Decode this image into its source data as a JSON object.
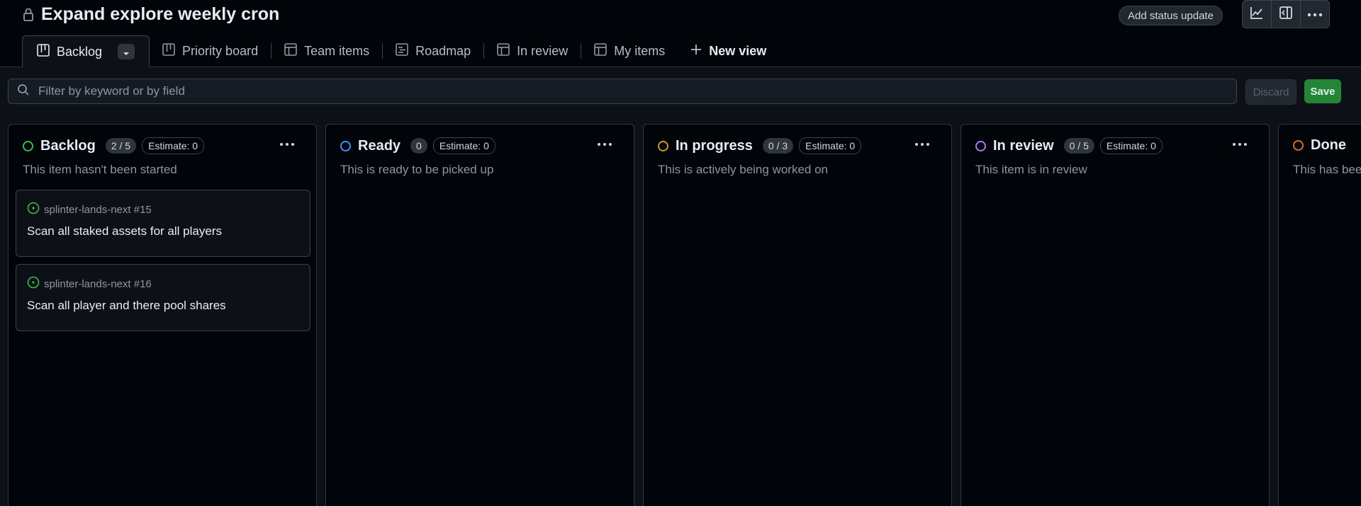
{
  "header": {
    "title": "Expand explore weekly cron",
    "status_button": "Add status update"
  },
  "tabs": [
    {
      "label": "Backlog",
      "icon": "board-icon",
      "active": true
    },
    {
      "label": "Priority board",
      "icon": "board-icon"
    },
    {
      "label": "Team items",
      "icon": "table-icon"
    },
    {
      "label": "Roadmap",
      "icon": "roadmap-icon"
    },
    {
      "label": "In review",
      "icon": "table-icon"
    },
    {
      "label": "My items",
      "icon": "table-icon"
    },
    {
      "label": "New view",
      "icon": "plus-icon"
    }
  ],
  "filter": {
    "placeholder": "Filter by keyword or by field",
    "discard_label": "Discard",
    "save_label": "Save"
  },
  "columns": [
    {
      "name": "Backlog",
      "count": "2 / 5",
      "estimate": "Estimate: 0",
      "description": "This item hasn't been started",
      "color": "#3fb950",
      "cards": [
        {
          "repo": "splinter-lands-next #15",
          "title": "Scan all staked assets for all players"
        },
        {
          "repo": "splinter-lands-next #16",
          "title": "Scan all player and there pool shares"
        }
      ]
    },
    {
      "name": "Ready",
      "count": "0",
      "estimate": "Estimate: 0",
      "description": "This is ready to be picked up",
      "color": "#4493f8"
    },
    {
      "name": "In progress",
      "count": "0 / 3",
      "estimate": "Estimate: 0",
      "description": "This is actively being worked on",
      "color": "#d29922"
    },
    {
      "name": "In review",
      "count": "0 / 5",
      "estimate": "Estimate: 0",
      "description": "This item is in review",
      "color": "#ab7df8"
    },
    {
      "name": "Done",
      "description": "This has bee",
      "color": "#db6d28"
    }
  ]
}
